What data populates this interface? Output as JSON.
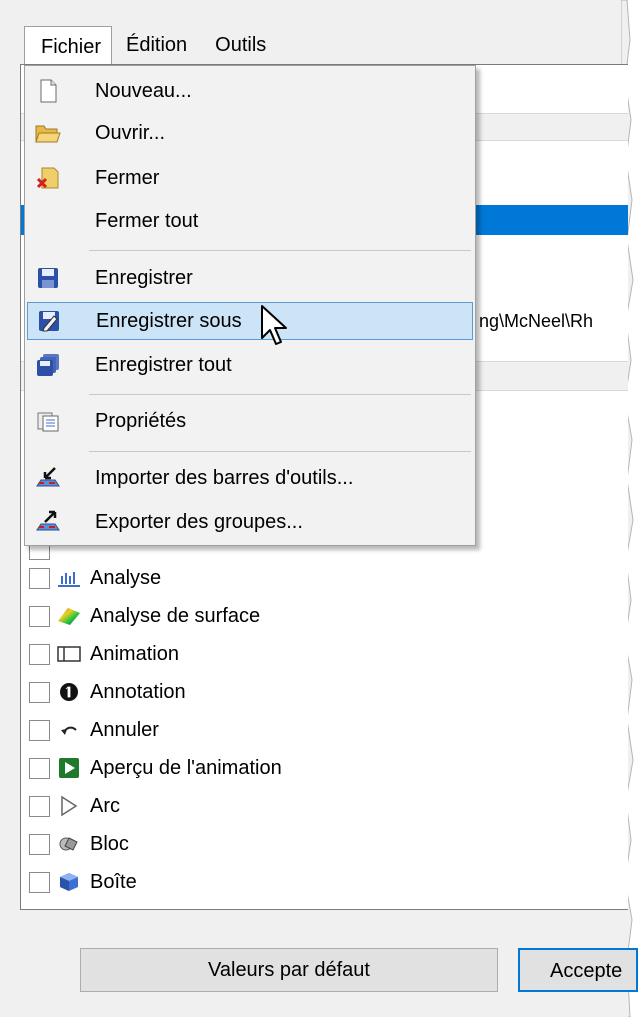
{
  "menubar": {
    "items": [
      {
        "label": "Fichier"
      },
      {
        "label": "Édition"
      },
      {
        "label": "Outils"
      }
    ]
  },
  "file_menu": {
    "items": [
      {
        "label": "Nouveau...",
        "icon": "new-document-icon"
      },
      {
        "label": "Ouvrir...",
        "icon": "open-folder-icon"
      },
      {
        "label": "Fermer",
        "icon": "close-file-icon"
      },
      {
        "label": "Fermer tout",
        "icon": ""
      },
      {
        "label": "Enregistrer",
        "icon": "save-disk-icon"
      },
      {
        "label": "Enregistrer sous",
        "icon": "save-as-icon",
        "hovered": true
      },
      {
        "label": "Enregistrer tout",
        "icon": "save-all-icon"
      },
      {
        "label": "Propriétés",
        "icon": "properties-icon"
      },
      {
        "label": "Importer des barres d'outils...",
        "icon": "import-toolbars-icon"
      },
      {
        "label": "Exporter des groupes...",
        "icon": "export-groups-icon"
      }
    ]
  },
  "background": {
    "path_fragment": "ng\\McNeel\\Rh"
  },
  "toolbar_list": {
    "items": [
      {
        "label": "Analyse",
        "icon": "analysis-icon"
      },
      {
        "label": "Analyse de surface",
        "icon": "surface-analysis-icon"
      },
      {
        "label": "Animation",
        "icon": "animation-icon"
      },
      {
        "label": "Annotation",
        "icon": "annotation-icon"
      },
      {
        "label": "Annuler",
        "icon": "undo-icon"
      },
      {
        "label": "Aperçu de l'animation",
        "icon": "animation-preview-icon"
      },
      {
        "label": "Arc",
        "icon": "arc-icon"
      },
      {
        "label": "Bloc",
        "icon": "block-icon"
      },
      {
        "label": "Boîte",
        "icon": "box-icon"
      }
    ]
  },
  "buttons": {
    "defaults": "Valeurs par défaut",
    "accept": "Accepte"
  },
  "colors": {
    "selection": "#0078d7",
    "menu_hover": "#cce4f7",
    "menu_hover_border": "#5a9bd5"
  }
}
